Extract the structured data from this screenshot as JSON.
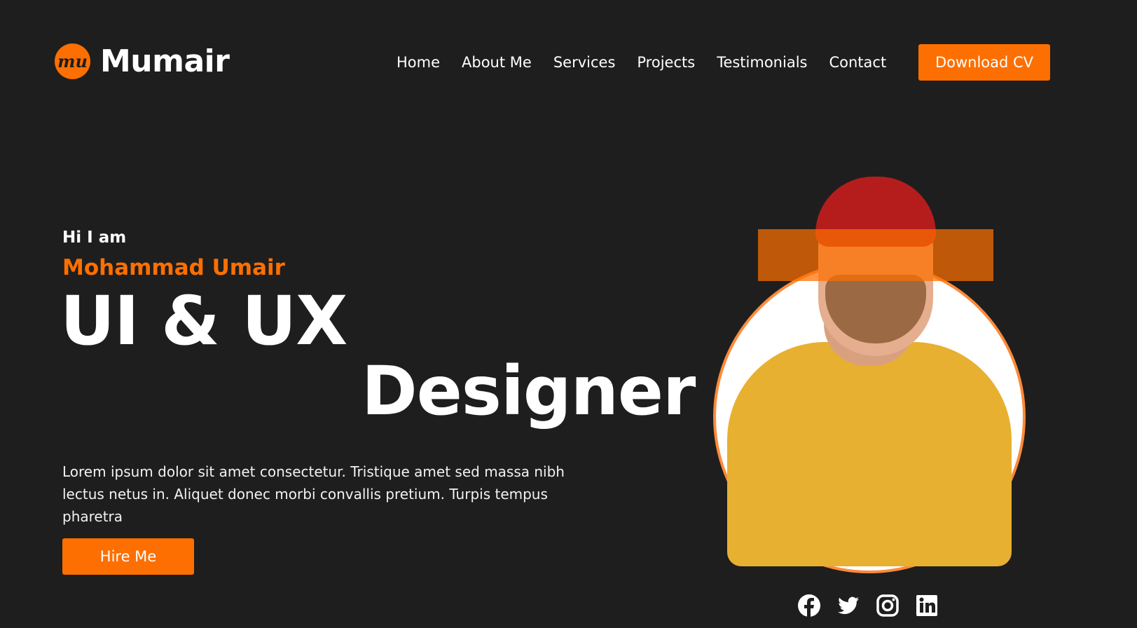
{
  "brand": {
    "logo_mark": "mu",
    "name_first": "M",
    "name_rest": "umair"
  },
  "nav": {
    "items": [
      {
        "label": "Home"
      },
      {
        "label": "About Me"
      },
      {
        "label": "Services"
      },
      {
        "label": "Projects"
      },
      {
        "label": "Testimonials"
      },
      {
        "label": "Contact"
      }
    ],
    "cta_label": "Download CV"
  },
  "hero": {
    "greeting": "Hi I am",
    "name": "Mohammad Umair",
    "title_line1": "UI & UX",
    "title_line2": "Designer",
    "description": "Lorem ipsum dolor sit amet consectetur. Tristique amet sed massa nibh lectus netus in. Aliquet donec morbi convallis pretium. Turpis tempus pharetra",
    "hire_label": "Hire Me"
  },
  "socials": [
    "facebook-icon",
    "twitter-icon",
    "instagram-icon",
    "linkedin-icon"
  ],
  "colors": {
    "background": "#1e1e1e",
    "accent": "#fd6f00",
    "text": "#ffffff"
  }
}
